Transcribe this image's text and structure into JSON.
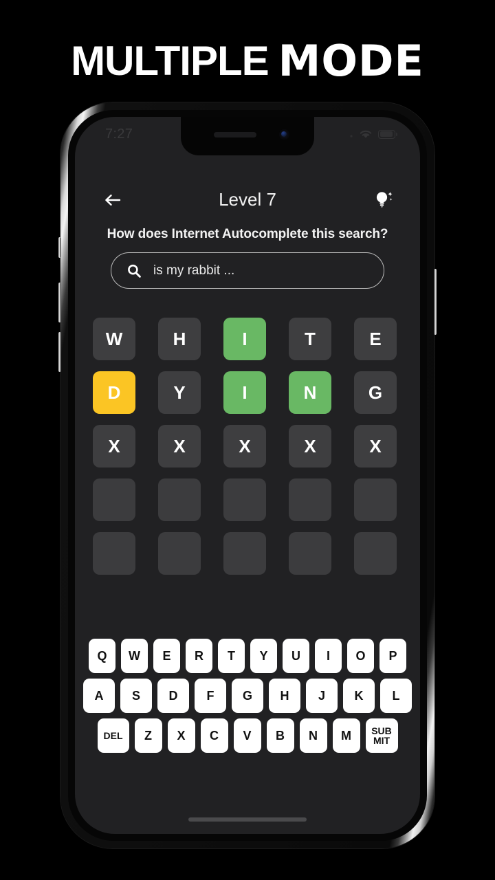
{
  "promo": {
    "title_part1": "MULTIPLE",
    "title_part2": "MODE"
  },
  "status_bar": {
    "time": "7:27",
    "wifi_icon": "wifi-icon",
    "battery_icon": "battery-icon",
    "signal_icon": "signal-icon"
  },
  "header": {
    "back_icon": "back-arrow-icon",
    "title": "Level 7",
    "hint_icon": "lightbulb-hint-icon"
  },
  "prompt": {
    "question": "How does Internet Autocomplete this search?"
  },
  "search": {
    "icon": "search-icon",
    "value": "is my rabbit ...",
    "placeholder": "is my rabbit ..."
  },
  "board": {
    "columns": 5,
    "rows": 5,
    "states": {
      "correct": "green",
      "present": "yellow",
      "absent": "gray",
      "empty": "empty"
    },
    "colors": {
      "green": "#69b864",
      "yellow": "#fbc524",
      "gray": "#3e3e40",
      "empty": "#3c3c3e",
      "background": "#212123",
      "tile_text": "#ffffff"
    },
    "guesses": [
      [
        {
          "letter": "W",
          "state": "absent"
        },
        {
          "letter": "H",
          "state": "absent"
        },
        {
          "letter": "I",
          "state": "correct"
        },
        {
          "letter": "T",
          "state": "absent"
        },
        {
          "letter": "E",
          "state": "absent"
        }
      ],
      [
        {
          "letter": "D",
          "state": "present"
        },
        {
          "letter": "Y",
          "state": "absent"
        },
        {
          "letter": "I",
          "state": "correct"
        },
        {
          "letter": "N",
          "state": "correct"
        },
        {
          "letter": "G",
          "state": "absent"
        }
      ],
      [
        {
          "letter": "X",
          "state": "absent"
        },
        {
          "letter": "X",
          "state": "absent"
        },
        {
          "letter": "X",
          "state": "absent"
        },
        {
          "letter": "X",
          "state": "absent"
        },
        {
          "letter": "X",
          "state": "absent"
        }
      ],
      [
        {
          "letter": "",
          "state": "empty"
        },
        {
          "letter": "",
          "state": "empty"
        },
        {
          "letter": "",
          "state": "empty"
        },
        {
          "letter": "",
          "state": "empty"
        },
        {
          "letter": "",
          "state": "empty"
        }
      ],
      [
        {
          "letter": "",
          "state": "empty"
        },
        {
          "letter": "",
          "state": "empty"
        },
        {
          "letter": "",
          "state": "empty"
        },
        {
          "letter": "",
          "state": "empty"
        },
        {
          "letter": "",
          "state": "empty"
        }
      ]
    ]
  },
  "keyboard": {
    "row1": [
      "Q",
      "W",
      "E",
      "R",
      "T",
      "Y",
      "U",
      "I",
      "O",
      "P"
    ],
    "row2": [
      "A",
      "S",
      "D",
      "F",
      "G",
      "H",
      "J",
      "K",
      "L"
    ],
    "row3": [
      "DEL",
      "Z",
      "X",
      "C",
      "V",
      "B",
      "N",
      "M",
      "SUBMIT"
    ],
    "delete_label": "DEL",
    "submit_label_line1": "SUB",
    "submit_label_line2": "MIT",
    "key_bg": "#ffffff",
    "key_text": "#111111"
  },
  "home_indicator": "home-indicator"
}
